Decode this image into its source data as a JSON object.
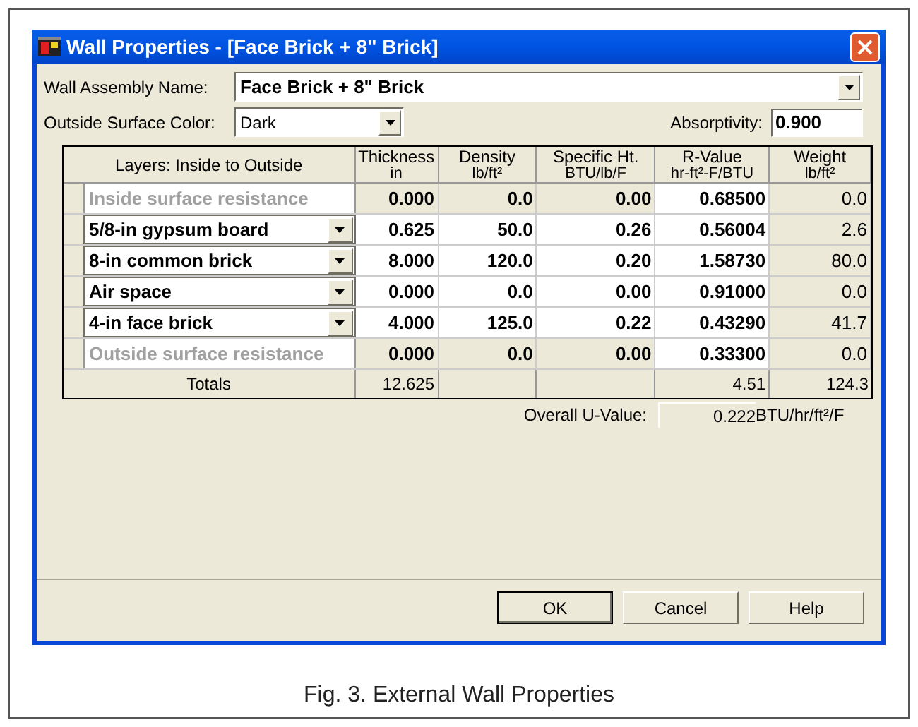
{
  "window": {
    "title": "Wall Properties - [Face Brick + 8\" Brick]"
  },
  "assembly_name": {
    "label": "Wall Assembly Name:",
    "value": "Face Brick + 8\" Brick"
  },
  "surface_color": {
    "label": "Outside Surface Color:",
    "value": "Dark"
  },
  "absorptivity": {
    "label": "Absorptivity:",
    "value": "0.900"
  },
  "table": {
    "columns": [
      {
        "line1": "Layers: Inside to Outside"
      },
      {
        "line1": "Thickness",
        "line2": "in"
      },
      {
        "line1": "Density",
        "line2": "lb/ft²"
      },
      {
        "line1": "Specific Ht.",
        "line2": "BTU/lb/F"
      },
      {
        "line1": "R-Value",
        "line2": "hr-ft²-F/BTU"
      },
      {
        "line1": "Weight",
        "line2": "lb/ft²"
      }
    ],
    "rows": [
      {
        "kind": "fixed",
        "cells": [
          "Inside surface resistance",
          "0.000",
          "0.0",
          "0.00",
          "0.68500",
          "0.0"
        ]
      },
      {
        "kind": "layer",
        "cells": [
          "5/8-in gypsum board",
          "0.625",
          "50.0",
          "0.26",
          "0.56004",
          "2.6"
        ]
      },
      {
        "kind": "layer",
        "cells": [
          "8-in common brick",
          "8.000",
          "120.0",
          "0.20",
          "1.58730",
          "80.0"
        ]
      },
      {
        "kind": "layer",
        "cells": [
          "Air space",
          "0.000",
          "0.0",
          "0.00",
          "0.91000",
          "0.0"
        ]
      },
      {
        "kind": "layer",
        "cells": [
          "4-in face brick",
          "4.000",
          "125.0",
          "0.22",
          "0.43290",
          "41.7"
        ]
      },
      {
        "kind": "fixed",
        "cells": [
          "Outside surface resistance",
          "0.000",
          "0.0",
          "0.00",
          "0.33300",
          "0.0"
        ]
      }
    ],
    "totals": {
      "label": "Totals",
      "thickness": "12.625",
      "r_value": "4.51",
      "weight": "124.3"
    }
  },
  "u_value": {
    "label": "Overall U-Value:",
    "value": "0.222",
    "unit": "BTU/hr/ft²/F"
  },
  "buttons": [
    {
      "label": "OK",
      "default": true
    },
    {
      "label": "Cancel",
      "default": false
    },
    {
      "label": "Help",
      "default": false
    }
  ],
  "caption": "Fig. 3. External Wall Properties"
}
